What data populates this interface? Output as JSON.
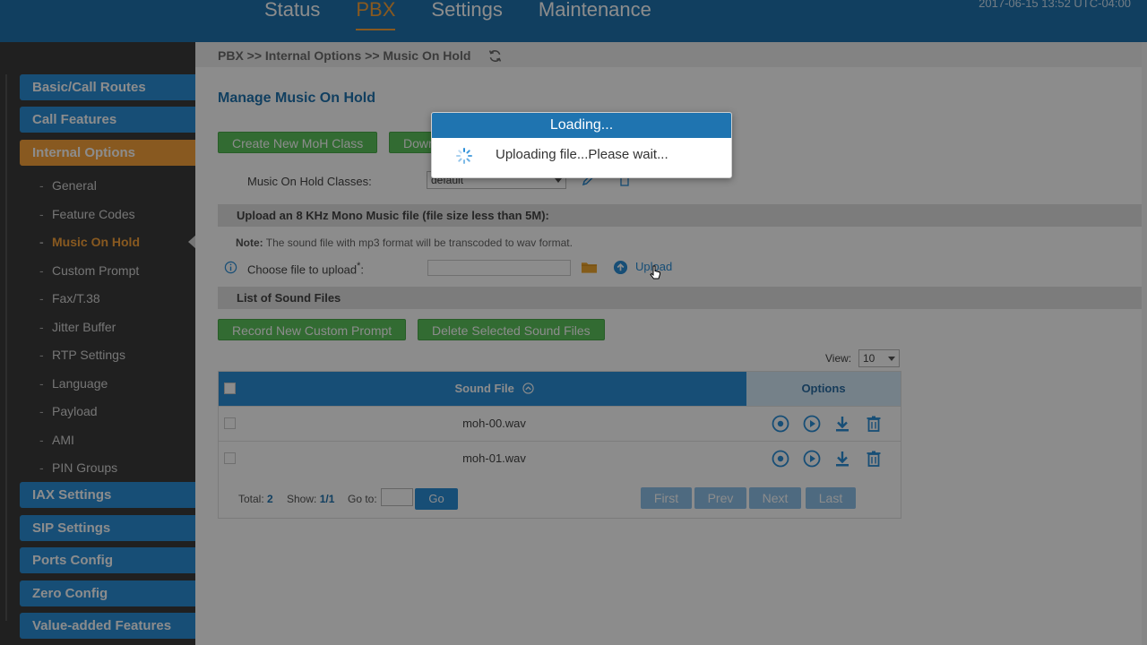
{
  "topnav": {
    "items": [
      "Status",
      "PBX",
      "Settings",
      "Maintenance"
    ],
    "active": "PBX",
    "datetime": "2017-06-15 13:52 UTC-04:00"
  },
  "sidebar": {
    "main": [
      {
        "label": "Basic/Call Routes"
      },
      {
        "label": "Call Features"
      },
      {
        "label": "Internal Options"
      },
      {
        "label": "IAX Settings"
      },
      {
        "label": "SIP Settings"
      },
      {
        "label": "Ports Config"
      },
      {
        "label": "Zero Config"
      },
      {
        "label": "Value-added Features"
      }
    ],
    "sub": [
      {
        "label": "General"
      },
      {
        "label": "Feature Codes"
      },
      {
        "label": "Music On Hold"
      },
      {
        "label": "Custom Prompt"
      },
      {
        "label": "Fax/T.38"
      },
      {
        "label": "Jitter Buffer"
      },
      {
        "label": "RTP Settings"
      },
      {
        "label": "Language"
      },
      {
        "label": "Payload"
      },
      {
        "label": "AMI"
      },
      {
        "label": "PIN Groups"
      }
    ]
  },
  "breadcrumb": "PBX >> Internal Options >> Music On Hold",
  "page": {
    "title": "Manage Music On Hold",
    "create_button": "Create New MoH Class",
    "download_button": "Download All",
    "moh_classes_label": "Music On Hold Classes:",
    "moh_classes_value": "default",
    "upload_section": "Upload an 8 KHz Mono Music file (file size less than 5M):",
    "note_label": "Note:",
    "note_text": " The sound file with mp3 format will be transcoded to wav format.",
    "choose_file_label": "Choose file to upload",
    "required_mark": "*",
    "choose_file_colon": ":",
    "upload_link": "Upload",
    "list_section": "List of Sound Files",
    "record_button": "Record New Custom Prompt",
    "delete_button": "Delete Selected Sound Files",
    "view_label": "View:",
    "view_value": "10"
  },
  "table": {
    "col_sound": "Sound File",
    "col_options": "Options",
    "rows": [
      {
        "file": "moh-00.wav"
      },
      {
        "file": "moh-01.wav"
      }
    ],
    "total_label": "Total:",
    "total_value": "2",
    "show_label": "Show:",
    "show_value": "1/1",
    "goto_label": "Go to:",
    "go_button": "Go",
    "pager": [
      "First",
      "Prev",
      "Next",
      "Last"
    ]
  },
  "dialog": {
    "title": "Loading...",
    "message": "Uploading file...Please wait..."
  },
  "colors": {
    "primary": "#1f74b0",
    "accent": "#f7a23b",
    "green": "#5cc35c"
  }
}
